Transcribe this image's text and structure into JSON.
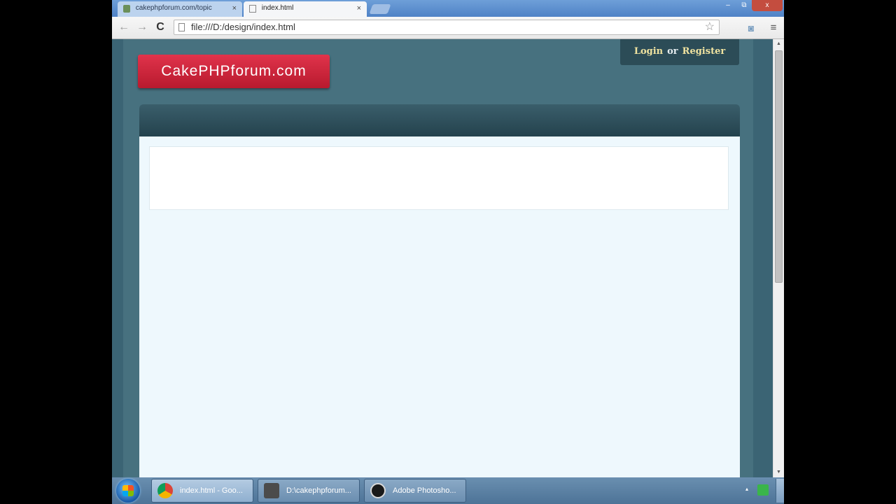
{
  "browser": {
    "tabs": [
      {
        "title": "cakephpforum.com/topic"
      },
      {
        "title": "index.html"
      }
    ],
    "tab_close_glyph": "×",
    "window_buttons": {
      "minimize": "–",
      "maximize": "⧉",
      "close": "x"
    },
    "nav": {
      "back": "←",
      "forward": "→",
      "reload": "C"
    },
    "address": {
      "url": "file:///D:/design/index.html",
      "star": "☆"
    },
    "camera_glyph": "◙",
    "menu_glyph": "≡"
  },
  "page": {
    "logo_text": "CakePHPforum.com",
    "login": {
      "login_text": "Login",
      "or_text": "or",
      "register_text": "Register"
    },
    "colors": {
      "logo_red": "#c8223a",
      "page_bg": "#47717f",
      "header_dark": "#2c4c57",
      "content_bg": "#eef8fd",
      "link_gold": "#f0e3a0"
    }
  },
  "scrollbar": {
    "up": "▲",
    "down": "▼"
  },
  "taskbar": {
    "tasks": [
      {
        "label": "index.html - Goo...",
        "icon": "chrome-icon"
      },
      {
        "label": "D:\\cakephpforum...",
        "icon": "sublime-text-icon"
      },
      {
        "label": "Adobe Photosho...",
        "icon": "photoshop-icon"
      }
    ],
    "tray_arrow": "▴"
  }
}
